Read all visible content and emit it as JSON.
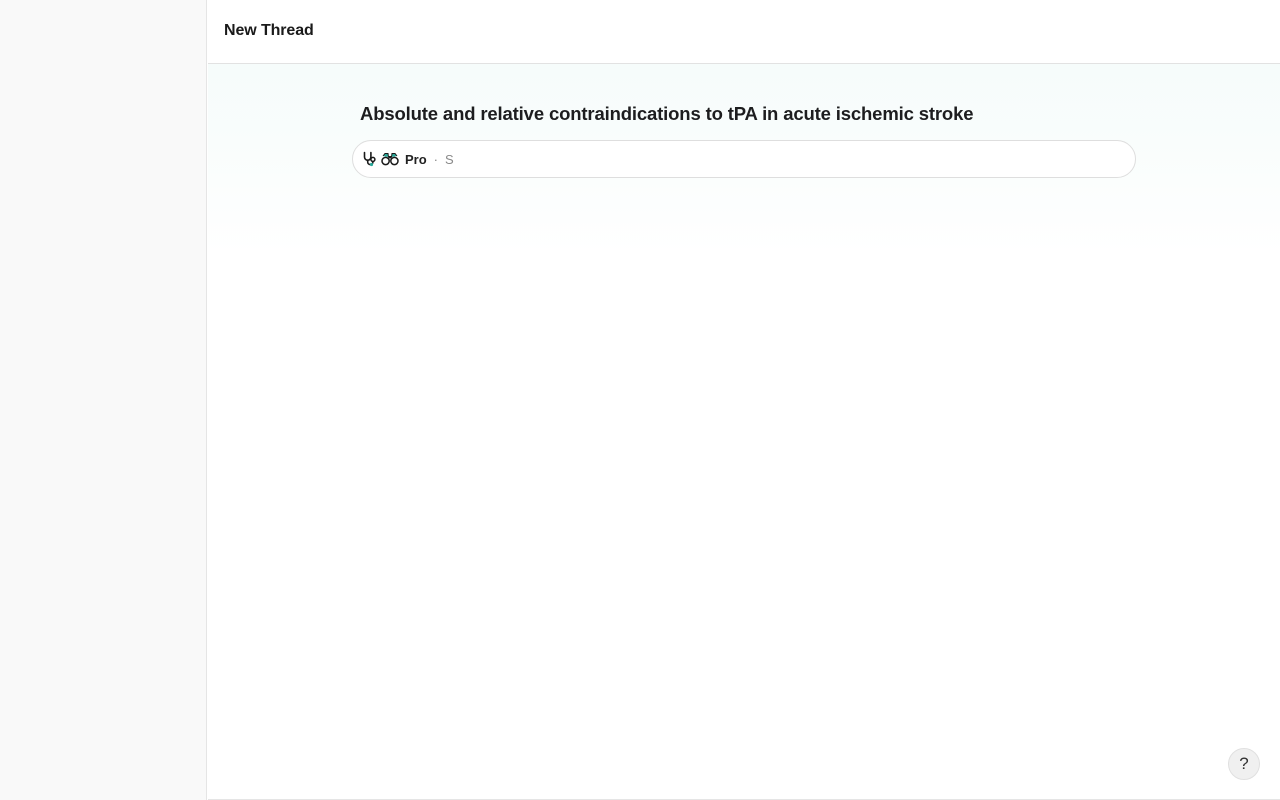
{
  "header": {
    "title": "New Thread"
  },
  "thread": {
    "title": "Absolute and relative contraindications to tPA in acute ischemic stroke"
  },
  "answer_bar": {
    "icons": [
      "stethoscope-icon",
      "binoculars-icon"
    ],
    "mode_label": "Pro",
    "separator": "·",
    "status_text": "S"
  },
  "help": {
    "label": "?"
  },
  "colors": {
    "accent_teal": "#2aa899",
    "sidebar_bg": "#f9f9f9",
    "content_tint": "#f6fcfb"
  }
}
